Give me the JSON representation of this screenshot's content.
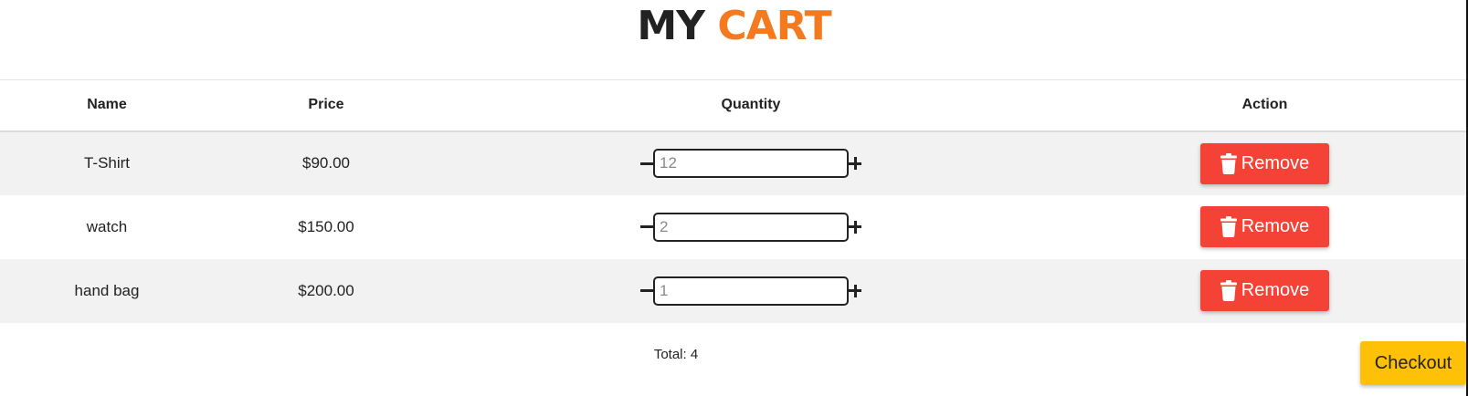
{
  "header": {
    "title_part1": "MY",
    "title_part2": "CART",
    "accent_color": "#f47a20"
  },
  "table": {
    "columns": [
      "Name",
      "Price",
      "Quantity",
      "Action"
    ],
    "rows": [
      {
        "name": "T-Shirt",
        "price": "$90.00",
        "quantity_placeholder": "12",
        "quantity_value": "",
        "action_label": "Remove"
      },
      {
        "name": "watch",
        "price": "$150.00",
        "quantity_placeholder": "2",
        "quantity_value": "",
        "action_label": "Remove"
      },
      {
        "name": "hand bag",
        "price": "$200.00",
        "quantity_placeholder": "1",
        "quantity_value": "",
        "action_label": "Remove"
      }
    ]
  },
  "icons": {
    "decrement": "minus-icon",
    "increment": "plus-icon",
    "remove": "trash-icon"
  },
  "colors": {
    "remove_button": "#f44336",
    "checkout_button": "#ffc107",
    "row_stripe": "#f2f2f2"
  },
  "footer": {
    "total_text": "Total: 4",
    "checkout_label": "Checkout"
  }
}
